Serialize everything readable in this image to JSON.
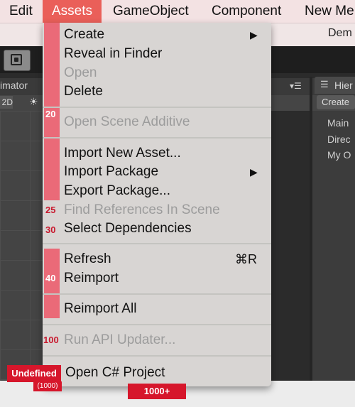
{
  "menubar": {
    "items": [
      "Edit",
      "Assets",
      "GameObject",
      "Component",
      "New Me"
    ],
    "active": "Assets"
  },
  "background": {
    "window_title": "Dem",
    "animator_tab": "imator",
    "hierarchy_tab": "Hier",
    "btn_2d": "2D",
    "create_button": "Create",
    "hierarchy_items": [
      "Main",
      "Direc",
      "My O"
    ]
  },
  "menu": {
    "items": [
      {
        "label": "Create",
        "submenu": true,
        "enabled": true
      },
      {
        "label": "Reveal in Finder",
        "enabled": true
      },
      {
        "label": "Open",
        "enabled": false
      },
      {
        "label": "Delete",
        "enabled": true
      },
      {
        "label": "Open Scene Additive",
        "enabled": false,
        "priority": "20"
      },
      {
        "label": "Import New Asset...",
        "enabled": true
      },
      {
        "label": "Import Package",
        "submenu": true,
        "enabled": true
      },
      {
        "label": "Export Package...",
        "enabled": true
      },
      {
        "label": "Find References In Scene",
        "enabled": false,
        "priority": "25"
      },
      {
        "label": "Select Dependencies",
        "enabled": true,
        "priority": "30"
      },
      {
        "label": "Refresh",
        "shortcut": "⌘R",
        "enabled": true
      },
      {
        "label": "Reimport",
        "enabled": true,
        "priority": "40"
      },
      {
        "label": "Reimport All",
        "enabled": true
      },
      {
        "label": "Run API Updater...",
        "enabled": false,
        "priority": "100"
      },
      {
        "label": "Open C# Project",
        "enabled": true
      }
    ]
  },
  "badges": {
    "undefined_label": "Undefined",
    "undefined_sub": "(1000)",
    "bottom_label": "1000+"
  },
  "colors": {
    "menubar_bg": "#f3e2e3",
    "active_menu": "#ea5f59",
    "priority_bar": "#ea6a78",
    "badge_red": "#d6162b",
    "priority_text": "#c8192e"
  }
}
